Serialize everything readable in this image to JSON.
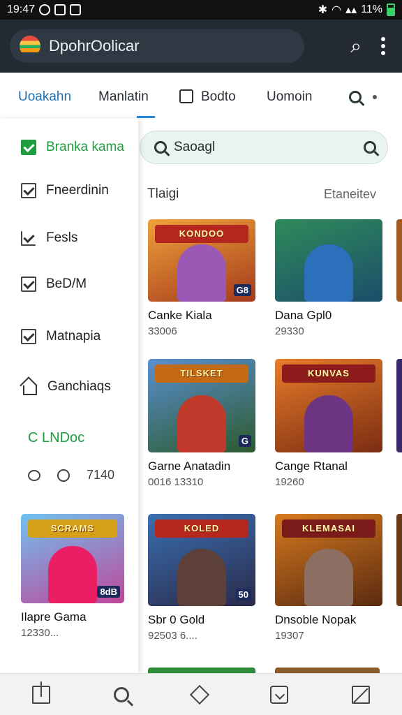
{
  "status_bar": {
    "time": "19:47",
    "battery": "11%",
    "icons": [
      "notification-icon",
      "photo-icon",
      "image-icon",
      "bluetooth-icon",
      "wifi-icon",
      "signal-icon",
      "battery-icon"
    ]
  },
  "app_bar": {
    "title": "DpohrOolicar",
    "actions": [
      "search-icon",
      "more-vert-icon"
    ]
  },
  "tabs": [
    {
      "label": "Uoakahn",
      "active": true
    },
    {
      "label": "Manlatin",
      "active": false
    },
    {
      "label": "Bodto",
      "active": false
    },
    {
      "label": "Uomoin",
      "active": false
    }
  ],
  "drawer": {
    "items": [
      {
        "label": "Branka kama",
        "icon": "checkbox-checked-green-icon"
      },
      {
        "label": "Fneerdinin",
        "icon": "checkbox-checked-icon"
      },
      {
        "label": "Fesls",
        "icon": "edit-check-icon"
      },
      {
        "label": "BeD/M",
        "icon": "checkbox-checked-icon"
      },
      {
        "label": "Matnapia",
        "icon": "checkbox-checked-icon"
      },
      {
        "label": "Ganchiaqs",
        "icon": "home-icon"
      }
    ],
    "heading": "C LNDoc",
    "meta_value": "7140"
  },
  "search": {
    "placeholder": "Saoagl"
  },
  "section": {
    "title": "Tlaigi",
    "more": "Etaneitev"
  },
  "games": [
    {
      "title": "Canke Kiala",
      "sub": "33006",
      "banner": "KONDOO",
      "tag": "G8",
      "colors": [
        "#f0a23a",
        "#a33a1c"
      ],
      "hero": "#9b59b6"
    },
    {
      "title": "Dana Gpl0",
      "sub": "29330",
      "banner": "",
      "tag": "",
      "colors": [
        "#2f8a5a",
        "#1b4d6b"
      ],
      "hero": "#2c6fbb"
    },
    {
      "title": "Garne Anatadin",
      "sub": "0016 13310",
      "banner": "TILSKET",
      "tag": "G",
      "colors": [
        "#5a8fd1",
        "#2c5a2c"
      ],
      "hero": "#c0392b"
    },
    {
      "title": "Cange Rtanal",
      "sub": "19260",
      "banner": "KUNVAS",
      "tag": "",
      "colors": [
        "#e87c2a",
        "#7a2c12"
      ],
      "hero": "#6c3483"
    },
    {
      "title": "Ilapre Gama",
      "sub": "12330...",
      "banner": "SCRAMS",
      "tag": "8dB",
      "colors": [
        "#6ec2f0",
        "#c0469a"
      ],
      "hero": "#e91e63"
    },
    {
      "title": "Sbr 0 Gold",
      "sub": "92503 6....",
      "banner": "KOLED",
      "tag": "50",
      "colors": [
        "#3a6fb0",
        "#2a2a4a"
      ],
      "hero": "#5d4037"
    },
    {
      "title": "Dnsoble Nopak",
      "sub": "19307",
      "banner": "KLEMASAI",
      "tag": "",
      "colors": [
        "#d67a1f",
        "#5a2a10"
      ],
      "hero": "#8d6e63"
    }
  ],
  "bottom_nav": [
    "document-icon",
    "search-icon",
    "diamond-icon",
    "bag-icon",
    "edit-icon"
  ]
}
